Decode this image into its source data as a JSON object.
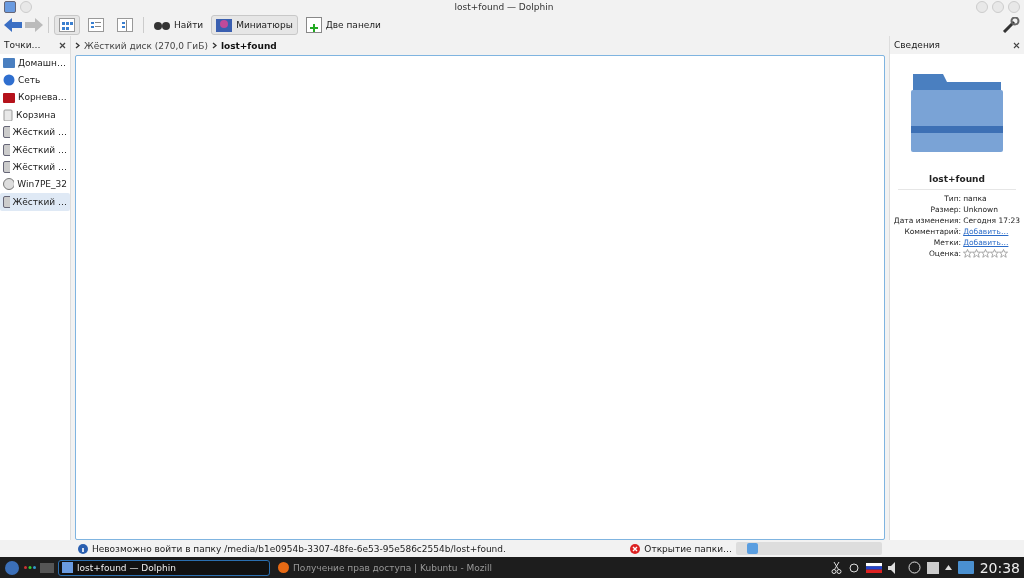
{
  "window": {
    "title": "lost+found — Dolphin"
  },
  "toolbar": {
    "view_modes": [
      {
        "kind": "icons",
        "selected": true
      },
      {
        "kind": "details",
        "selected": false
      },
      {
        "kind": "columns",
        "selected": false
      }
    ],
    "buttons": [
      {
        "kind": "find",
        "label": "Найти",
        "on": false
      },
      {
        "kind": "preview",
        "label": "Миниатюры",
        "on": true
      },
      {
        "kind": "split",
        "label": "Две панели",
        "on": false
      }
    ]
  },
  "places": {
    "title": "Точки…",
    "items": [
      {
        "kind": "home",
        "label": "Домашн…",
        "selected": false
      },
      {
        "kind": "network",
        "label": "Сеть",
        "selected": false
      },
      {
        "kind": "root",
        "label": "Корнева…",
        "selected": false
      },
      {
        "kind": "trash",
        "label": "Корзина",
        "selected": false
      },
      {
        "kind": "drive",
        "label": "Жёсткий …",
        "selected": false
      },
      {
        "kind": "drive",
        "label": "Жёсткий …",
        "selected": false
      },
      {
        "kind": "drive",
        "label": "Жёсткий …",
        "selected": false
      },
      {
        "kind": "disc",
        "label": "Win7PE_32",
        "selected": false
      },
      {
        "kind": "drive",
        "label": "Жёсткий …",
        "selected": true
      }
    ]
  },
  "breadcrumb": [
    "Жёсткий диск (270,0 ГиБ)",
    "lost+found"
  ],
  "info": {
    "title": "Сведения",
    "name": "lost+found",
    "fields": [
      {
        "label": "Тип:",
        "value": "папка",
        "kind": "text"
      },
      {
        "label": "Размер:",
        "value": "Unknown",
        "kind": "text"
      },
      {
        "label": "Дата изменения:",
        "value": "Сегодня 17:23",
        "kind": "text"
      },
      {
        "label": "Комментарий:",
        "value": "Добавить…",
        "kind": "link"
      },
      {
        "label": "Метки:",
        "value": "Добавить…",
        "kind": "link"
      },
      {
        "label": "Оценка:",
        "kind": "rating",
        "stars": 0
      }
    ]
  },
  "status": {
    "message": "Невозможно войти в папку /media/b1e0954b-3307-48fe-6e53-95e586c2554b/lost+found.",
    "job": "Открытие папки…"
  },
  "taskbar": {
    "tasks": [
      {
        "label": "lost+found — Dolphin",
        "selected": true,
        "kind": "dolphin"
      },
      {
        "label": "Получение прав доступа | Kubuntu - Mozill",
        "selected": false,
        "kind": "browser"
      }
    ],
    "clock": "20:38"
  }
}
